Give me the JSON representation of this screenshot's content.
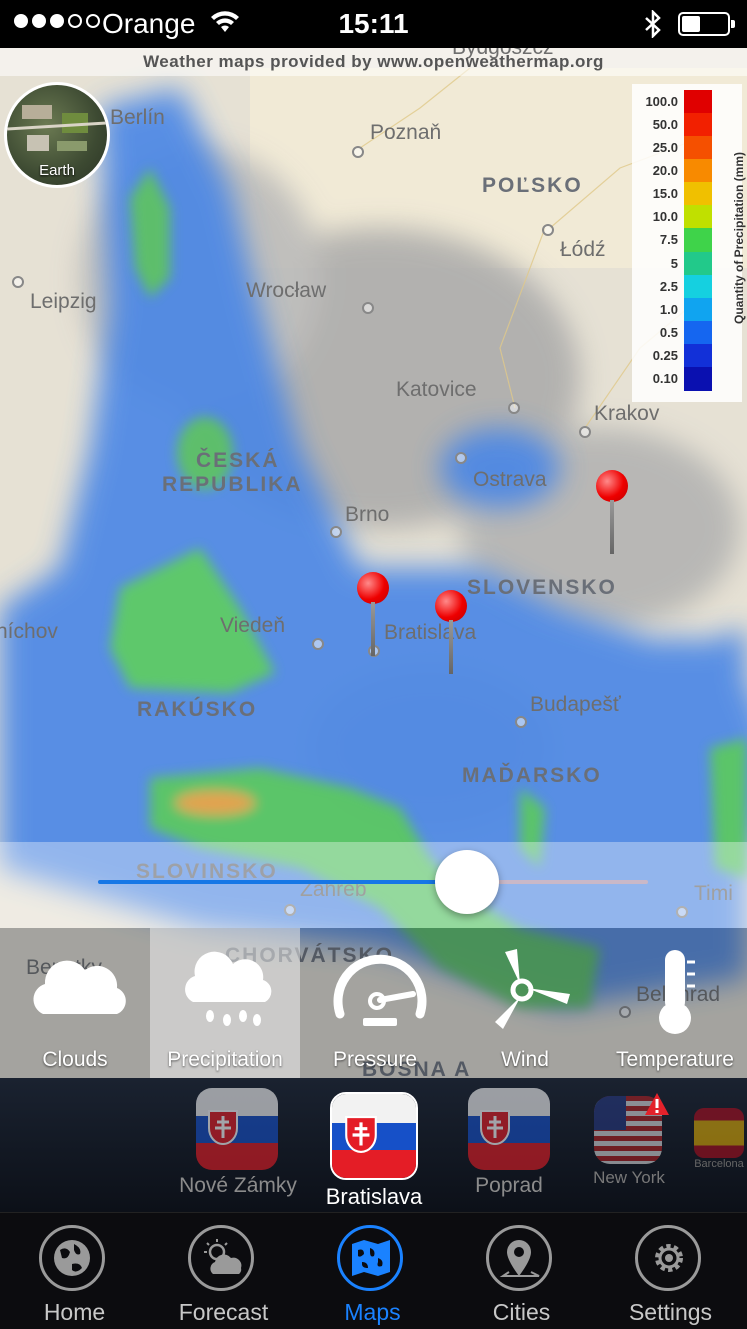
{
  "status_bar": {
    "carrier": "Orange",
    "time": "15:11",
    "signal_bars": 3,
    "signal_max": 5
  },
  "map": {
    "credit": "Weather maps provided by www.openweathermap.org",
    "earth_button_label": "Earth",
    "cities": [
      "Bydgoszcz",
      "Berlín",
      "Poznaň",
      "Łódź",
      "Leipzig",
      "Wrocław",
      "Katovice",
      "Krakov",
      "Ostrava",
      "Brno",
      "Viedeň",
      "Bratislava",
      "Budapešť",
      "Zahreb",
      "Timi",
      "Belehrad",
      "Benatky",
      "níchov"
    ],
    "countries": [
      "POĽSKO",
      "ČESKÁ",
      "REPUBLIKA",
      "SLOVENSKO",
      "RAKÚSKO",
      "MAĎARSKO",
      "SLOVINSKO",
      "CHORVÁTSKO",
      "BOSNA A"
    ],
    "legend": {
      "title": "Quantity of Precipitation (mm)",
      "values": [
        "100.0",
        "50.0",
        "25.0",
        "20.0",
        "15.0",
        "10.0",
        "7.5",
        "5",
        "2.5",
        "1.0",
        "0.5",
        "0.25",
        "0.10"
      ],
      "colors": [
        "#e00000",
        "#f22000",
        "#f55000",
        "#f88a00",
        "#f0c000",
        "#c0e000",
        "#3fd34a",
        "#22c98a",
        "#15d0e0",
        "#10a4f0",
        "#1566f0",
        "#1230d8",
        "#0a10b0"
      ]
    },
    "timeline_slider": {
      "value": 0.67
    }
  },
  "layers": [
    {
      "label": "Clouds",
      "icon": "cloud-icon",
      "active": false
    },
    {
      "label": "Precipitation",
      "icon": "rain-cloud-icon",
      "active": true
    },
    {
      "label": "Pressure",
      "icon": "gauge-icon",
      "active": false
    },
    {
      "label": "Wind",
      "icon": "wind-turbine-icon",
      "active": false
    },
    {
      "label": "Temperature",
      "icon": "thermometer-icon",
      "active": false
    }
  ],
  "saved_cities": [
    {
      "name": "Nové Zámky",
      "selected": false
    },
    {
      "name": "Bratislava",
      "selected": true
    },
    {
      "name": "Poprad",
      "selected": false
    },
    {
      "name": "New York",
      "selected": false,
      "alert": true
    },
    {
      "name": "Barcelona",
      "selected": false
    }
  ],
  "tabs": [
    {
      "label": "Home",
      "icon": "globe-icon",
      "active": false
    },
    {
      "label": "Forecast",
      "icon": "sun-cloud-icon",
      "active": false
    },
    {
      "label": "Maps",
      "icon": "map-icon",
      "active": true
    },
    {
      "label": "Cities",
      "icon": "location-pin-icon",
      "active": false
    },
    {
      "label": "Settings",
      "icon": "gear-icon",
      "active": false
    }
  ],
  "colors": {
    "accent": "#1a82ff",
    "pin": "#e00000"
  }
}
